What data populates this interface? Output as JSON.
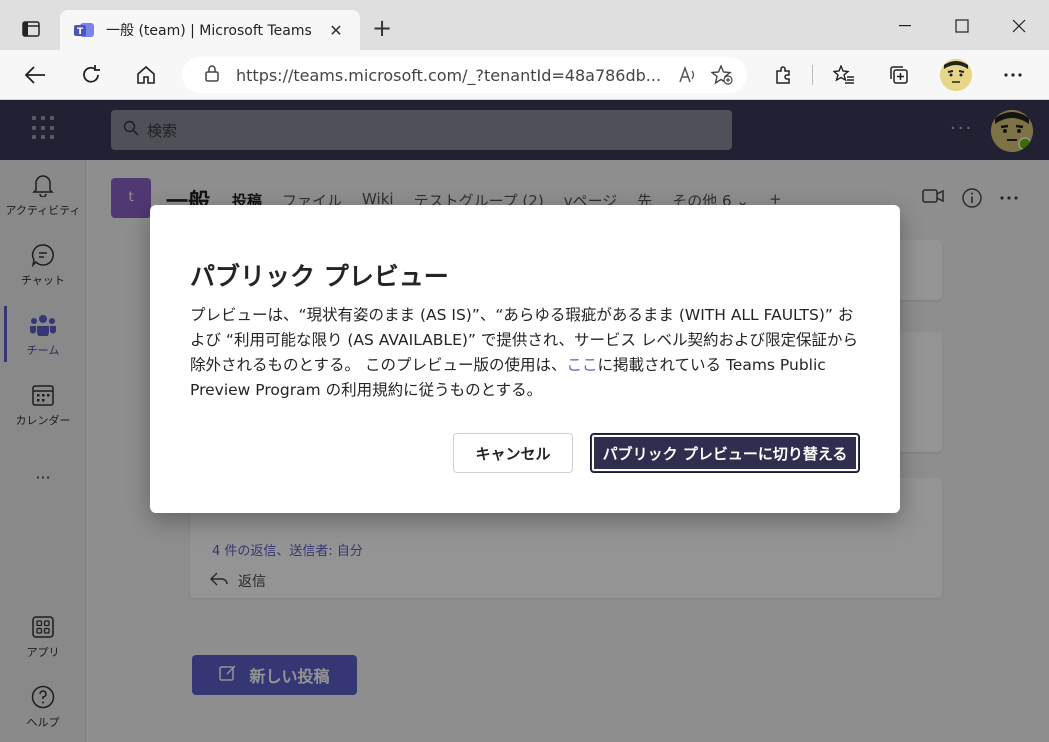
{
  "browser": {
    "tab_title": "一般 (team) | Microsoft Teams",
    "tab_close": "✕",
    "new_tab": "+",
    "url": "https://teams.microsoft.com/_?tenantId=48a786db..."
  },
  "teams": {
    "search_placeholder": "検索",
    "more": "···"
  },
  "rail": {
    "items": [
      {
        "label": "アクティビティ"
      },
      {
        "label": "チャット"
      },
      {
        "label": "チーム"
      },
      {
        "label": "カレンダー"
      },
      {
        "label": "···"
      },
      {
        "label": "アプリ"
      },
      {
        "label": "ヘルプ"
      }
    ]
  },
  "channel": {
    "team_initial": "t",
    "title": "一般",
    "tabs": [
      "投稿",
      "ファイル",
      "Wiki",
      "テストグループ (2)",
      "vページ",
      "先",
      "その他 6 ⌄",
      "+"
    ],
    "replies_text": "4 件の返信、送信者: 自分",
    "reply_label": "返信",
    "new_post_label": "新しい投稿"
  },
  "dialog": {
    "title": "パブリック プレビュー",
    "body_part1": "プレビューは、“現状有姿のまま (AS IS)”、“あらゆる瑕疵があるまま (WITH ALL FAULTS)” および “利用可能な限り (AS AVAILABLE)” で提供され、サービス レベル契約および限定保証から除外されるものとする。 このプレビュー版の使用は、",
    "body_link": "ここ",
    "body_part2": "に掲載されている Teams Public Preview Program の利用規約に従うものとする。",
    "cancel_label": "キャンセル",
    "confirm_label": "パブリック プレビューに切り替える"
  },
  "colors": {
    "accent": "#5b5fc7",
    "header": "#3b3a59",
    "primary_button": "#2f2e4f"
  }
}
